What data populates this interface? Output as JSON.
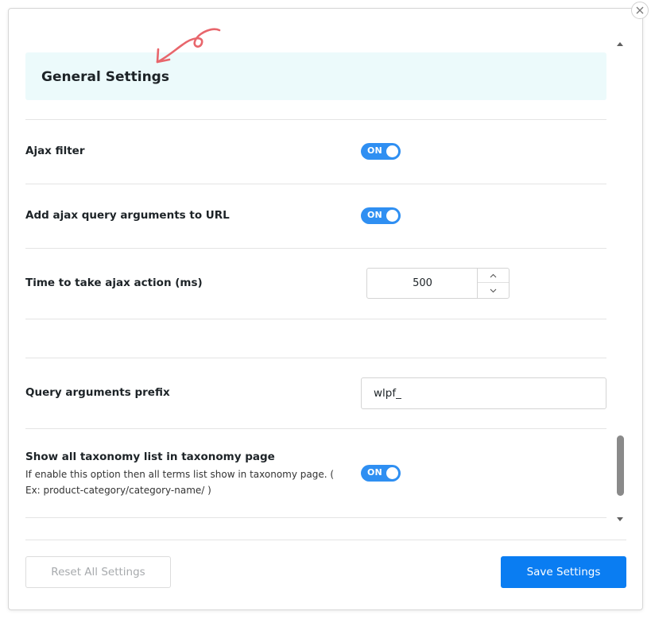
{
  "header": {
    "title": "General Settings"
  },
  "settings": {
    "ajax_filter": {
      "label": "Ajax filter",
      "toggle_label": "ON"
    },
    "add_query_args": {
      "label": "Add ajax query arguments to URL",
      "toggle_label": "ON"
    },
    "ajax_action_time": {
      "label": "Time to take ajax action (ms)",
      "value": "500"
    },
    "query_prefix": {
      "label": "Query arguments prefix",
      "value": "wlpf_"
    },
    "show_taxonomy_list": {
      "label": "Show all taxonomy list in taxonomy page",
      "description": "If enable this option then all terms list show in taxonomy page. ( Ex: product-category/category-name/ )",
      "toggle_label": "ON"
    }
  },
  "footer": {
    "reset_label": "Reset All Settings",
    "save_label": "Save Settings"
  },
  "icons": {
    "close": "close-icon",
    "arrow_annotation": "curved-arrow-icon",
    "chevron_up": "chevron-up-icon",
    "chevron_down": "chevron-down-icon"
  },
  "colors": {
    "toggle_on": "#2f8ff2",
    "save_button": "#0a7df2",
    "header_bg": "#ecfafb",
    "annotation": "#e8666c"
  }
}
